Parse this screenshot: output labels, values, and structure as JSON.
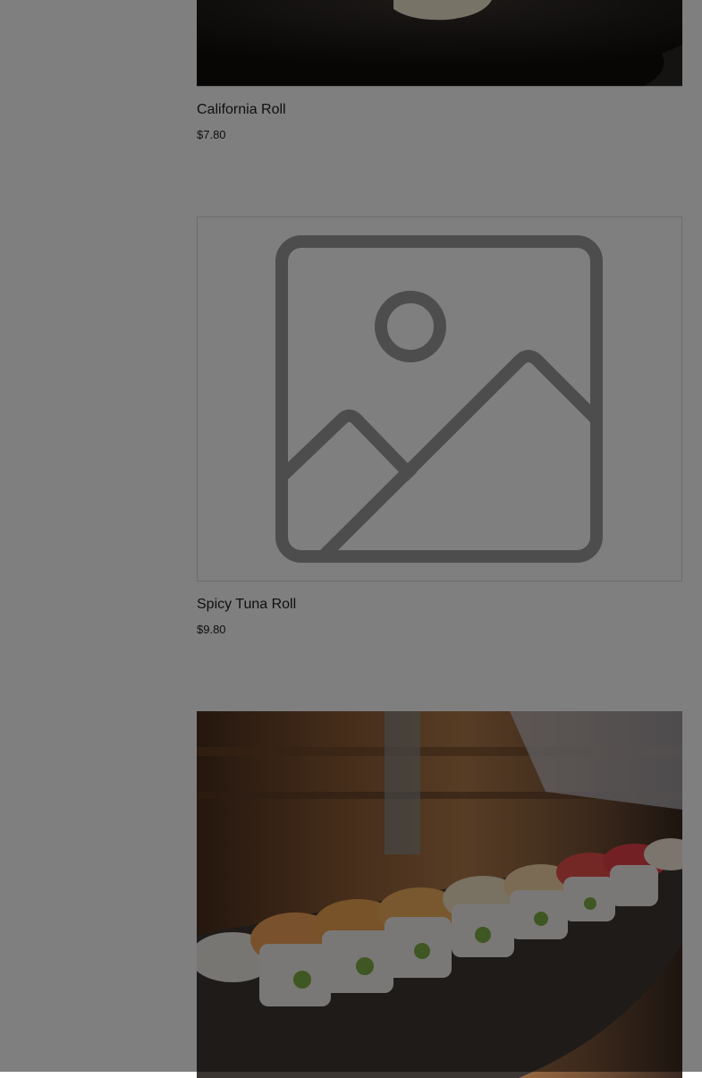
{
  "menu_items": [
    {
      "name": "California Roll",
      "price": "$7.80",
      "image": "photo"
    },
    {
      "name": "Spicy Tuna Roll",
      "price": "$9.80",
      "image": "image-placeholder-icon"
    },
    {
      "name": "",
      "price": "",
      "image": "photo"
    }
  ],
  "overlay": {
    "color": "#000000",
    "opacity": 0.5
  }
}
